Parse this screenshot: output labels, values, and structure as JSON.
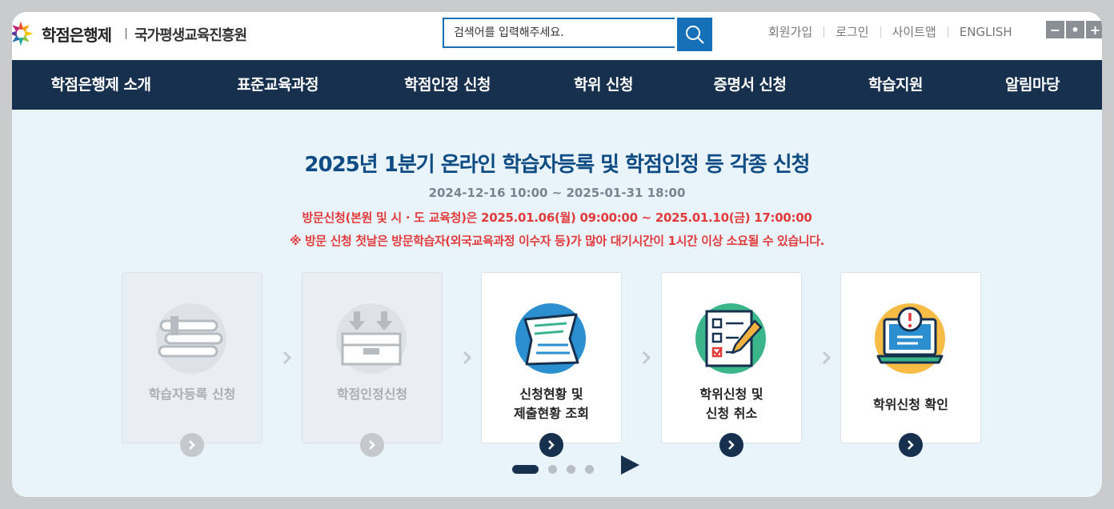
{
  "header": {
    "logo_text": "학점은행제",
    "org_name": "국가평생교육진흥원",
    "search_placeholder": "검색어를 입력해주세요.",
    "links": [
      "회원가입",
      "로그인",
      "사이트맵",
      "ENGLISH"
    ],
    "zoom": [
      "−",
      "•",
      "+"
    ]
  },
  "nav": {
    "items": [
      "학점은행제 소개",
      "표준교육과정",
      "학점인정 신청",
      "학위 신청",
      "증명서 신청",
      "학습지원",
      "알림마당"
    ]
  },
  "banner": {
    "title": "2025년 1분기 온라인 학습자등록 및 학점인정 등 각종 신청",
    "date_range": "2024-12-16 10:00 ~ 2025-01-31 18:00",
    "visit_notice": "방문신청(본원 및 시 · 도 교육청)은 2025.01.06(월) 09:00:00 ~ 2025.01.10(금) 17:00:00",
    "warning": "※ 방문 신청 첫날은 방문학습자(외국교육과정 이수자 등)가 많아 대기시간이 1시간 이상 소요될 수 있습니다."
  },
  "cards": [
    {
      "line1": "학습자등록 신청",
      "line2": "",
      "icon": "books-icon",
      "state": "disabled"
    },
    {
      "line1": "학점인정신청",
      "line2": "",
      "icon": "inbox-tray-icon",
      "state": "disabled"
    },
    {
      "line1": "신청현황 및",
      "line2": "제출현황 조회",
      "icon": "document-icon",
      "state": "active"
    },
    {
      "line1": "학위신청 및",
      "line2": "신청 취소",
      "icon": "checklist-pencil-icon",
      "state": "active"
    },
    {
      "line1": "학위신청 확인",
      "line2": "",
      "icon": "laptop-alert-icon",
      "state": "active"
    }
  ],
  "carousel": {
    "pages": 4,
    "current": 1
  },
  "colors": {
    "nav_bg": "#16304e",
    "accent": "#1570b7",
    "title": "#0f4c84",
    "alert": "#e23b3b"
  }
}
